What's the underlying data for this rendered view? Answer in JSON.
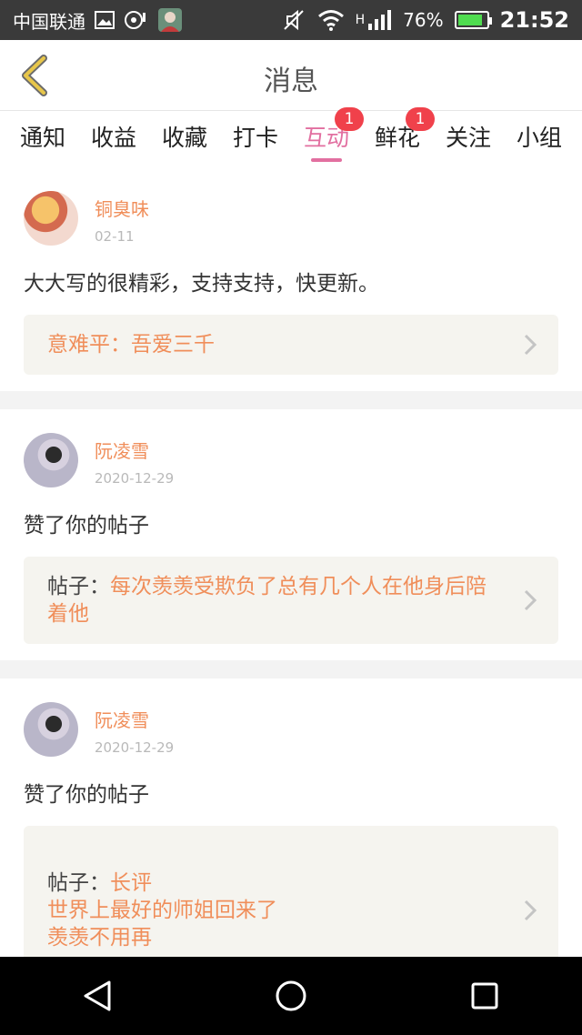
{
  "status_bar": {
    "carrier": "中国联通",
    "network": "H",
    "battery": "76%",
    "battery_level": 0.76,
    "time": "21:52"
  },
  "header": {
    "title": "消息",
    "back_icon": "chevron-left-icon",
    "accent_color": "#e7c64a"
  },
  "tabs": [
    {
      "label": "通知",
      "badge": ""
    },
    {
      "label": "收益",
      "badge": ""
    },
    {
      "label": "收藏",
      "badge": ""
    },
    {
      "label": "打卡",
      "badge": ""
    },
    {
      "label": "互动",
      "badge": "1",
      "active": true
    },
    {
      "label": "鲜花",
      "badge": "1"
    },
    {
      "label": "关注",
      "badge": ""
    },
    {
      "label": "小组",
      "badge": ""
    }
  ],
  "messages": [
    {
      "author": "铜臭味",
      "date": "02-11",
      "content": "大大写的很精彩，支持支持，快更新。",
      "ref_label": "意难平：",
      "ref_value": "吾爱三千"
    },
    {
      "author": "阮凌雪",
      "date": "2020-12-29",
      "content": "赞了你的帖子",
      "ref_label": "帖子：",
      "ref_value": "每次羡羡受欺负了总有几个人在他身后陪着他"
    },
    {
      "author": "阮凌雪",
      "date": "2020-12-29",
      "content": "赞了你的帖子",
      "ref_label": "帖子：",
      "ref_value": "长评\n世界上最好的师姐回来了\n羡羡不用再"
    }
  ],
  "colors": {
    "tab_active": "#e26fa0",
    "badge": "#f0414b",
    "author": "#f08e5a"
  }
}
